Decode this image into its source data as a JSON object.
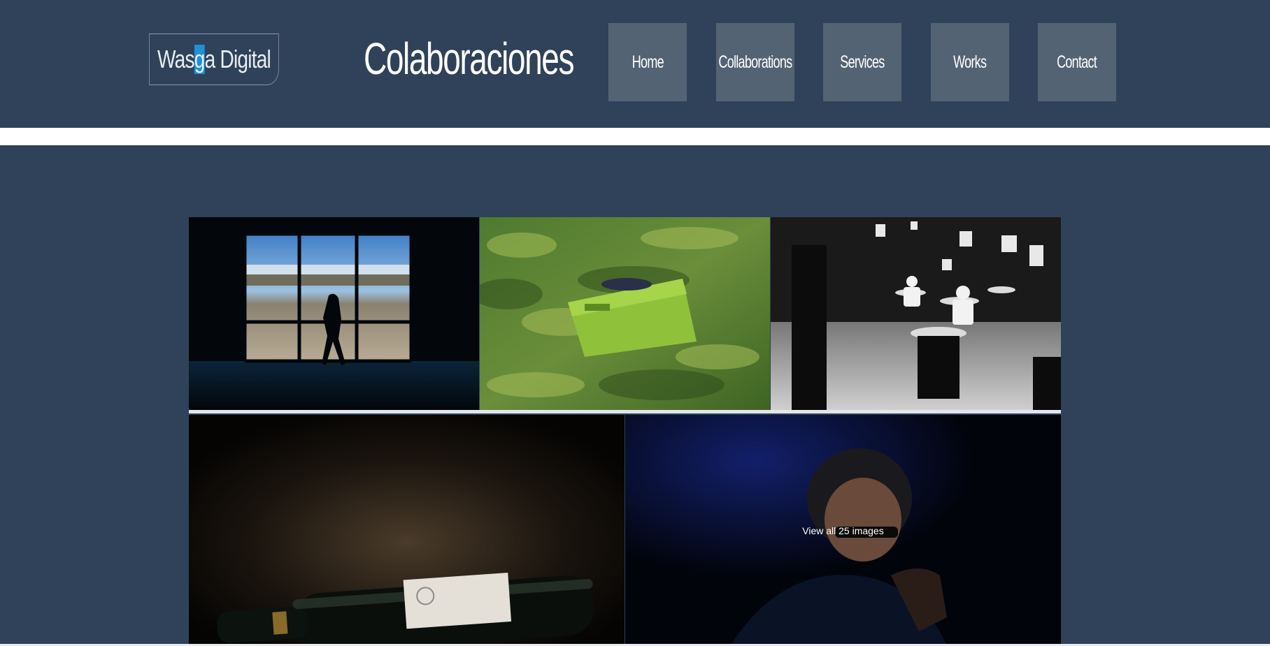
{
  "header": {
    "logo": {
      "before": "Was",
      "highlight": "g",
      "after": "a Digital"
    },
    "title": "Colaboraciones",
    "nav": [
      {
        "label": "Home"
      },
      {
        "label": "Collaborations"
      },
      {
        "label": "Services"
      },
      {
        "label": "Works"
      },
      {
        "label": "Contact"
      }
    ]
  },
  "gallery": {
    "images": [
      {
        "name": "person-walking-window-vineyard-photo"
      },
      {
        "name": "green-grape-crate-vineyard-photo"
      },
      {
        "name": "black-white-cafe-interior-photo"
      },
      {
        "name": "wine-bottle-photo"
      },
      {
        "name": "man-sunglasses-portrait-photo"
      }
    ],
    "view_all_label": "View all 25 images"
  },
  "colors": {
    "header_bg": "#2f4259",
    "nav_button_bg": "#546374",
    "logo_highlight": "#1d90d8"
  }
}
